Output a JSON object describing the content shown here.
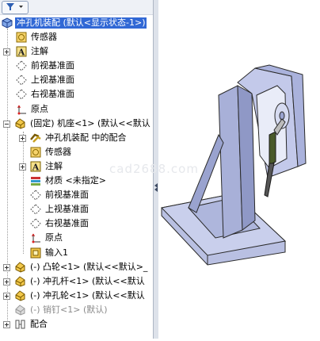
{
  "filter": {
    "icon": "funnel-filter-icon"
  },
  "tree": {
    "root": {
      "label": "冲孔机装配 (默认<显示状态-1>)",
      "icon": "assembly-icon"
    },
    "items": [
      {
        "label": "传感器",
        "icon": "sensor-icon"
      },
      {
        "label": "注解",
        "icon": "annotation-icon"
      },
      {
        "label": "前视基准面",
        "icon": "plane-icon"
      },
      {
        "label": "上视基准面",
        "icon": "plane-icon"
      },
      {
        "label": "右视基准面",
        "icon": "plane-icon"
      },
      {
        "label": "原点",
        "icon": "origin-icon"
      },
      {
        "label": "(固定) 机座<1> (默认<<默认",
        "icon": "part-icon"
      },
      {
        "label": "冲孔机装配 中的配合",
        "icon": "mate-icon"
      },
      {
        "label": "传感器",
        "icon": "sensor-icon"
      },
      {
        "label": "注解",
        "icon": "annotation-icon"
      },
      {
        "label": "材质 <未指定>",
        "icon": "material-icon"
      },
      {
        "label": "前视基准面",
        "icon": "plane-icon"
      },
      {
        "label": "上视基准面",
        "icon": "plane-icon"
      },
      {
        "label": "右视基准面",
        "icon": "plane-icon"
      },
      {
        "label": "原点",
        "icon": "origin-icon"
      },
      {
        "label": "输入1",
        "icon": "import-feature-icon"
      },
      {
        "label": "(-) 凸轮<1> (默认<<默认>_",
        "icon": "part-icon"
      },
      {
        "label": "(-) 冲孔杆<1> (默认<<默认",
        "icon": "part-icon"
      },
      {
        "label": "(-) 冲孔轮<1> (默认<<默认",
        "icon": "part-icon"
      },
      {
        "label": "(-) 销钉<1> (默认)",
        "icon": "part-suppressed-icon"
      },
      {
        "label": "配合",
        "icon": "mates-folder-icon"
      }
    ]
  },
  "viewport": {
    "watermark": "cad2688.com",
    "model": "punching-machine-3d-model"
  },
  "colors": {
    "selection": "#3168d5",
    "model_body": "#b7bee0",
    "model_edge": "#2a2a2a"
  }
}
